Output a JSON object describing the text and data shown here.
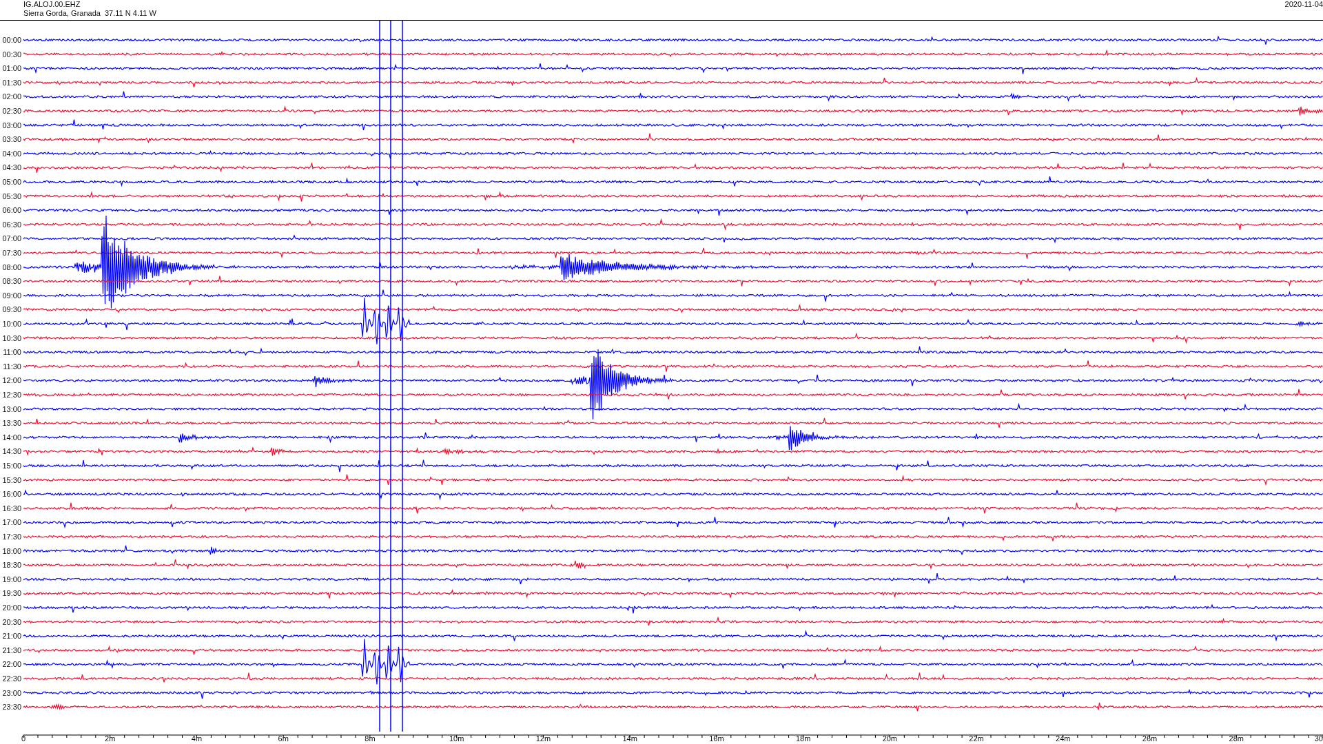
{
  "header": {
    "station": "IG.ALOJ.00.EHZ",
    "location": "Sierra Gorda, Granada  37.11 N 4.11 W",
    "date": "2020-11-04"
  },
  "helicorder": {
    "rows": [
      {
        "label": "00:00",
        "color": "#0000ff"
      },
      {
        "label": "00:30",
        "color": "#ee1133"
      },
      {
        "label": "01:00",
        "color": "#0000ff"
      },
      {
        "label": "01:30",
        "color": "#ee1133"
      },
      {
        "label": "02:00",
        "color": "#0000ff"
      },
      {
        "label": "02:30",
        "color": "#ee1133"
      },
      {
        "label": "03:00",
        "color": "#0000ff"
      },
      {
        "label": "03:30",
        "color": "#ee1133"
      },
      {
        "label": "04:00",
        "color": "#0000ff"
      },
      {
        "label": "04:30",
        "color": "#ee1133"
      },
      {
        "label": "05:00",
        "color": "#0000ff"
      },
      {
        "label": "05:30",
        "color": "#ee1133"
      },
      {
        "label": "06:00",
        "color": "#0000ff"
      },
      {
        "label": "06:30",
        "color": "#ee1133"
      },
      {
        "label": "07:00",
        "color": "#0000ff"
      },
      {
        "label": "07:30",
        "color": "#ee1133"
      },
      {
        "label": "08:00",
        "color": "#0000ff"
      },
      {
        "label": "08:30",
        "color": "#ee1133"
      },
      {
        "label": "09:00",
        "color": "#0000ff"
      },
      {
        "label": "09:30",
        "color": "#ee1133"
      },
      {
        "label": "10:00",
        "color": "#0000ff"
      },
      {
        "label": "10:30",
        "color": "#ee1133"
      },
      {
        "label": "11:00",
        "color": "#0000ff"
      },
      {
        "label": "11:30",
        "color": "#ee1133"
      },
      {
        "label": "12:00",
        "color": "#0000ff"
      },
      {
        "label": "12:30",
        "color": "#ee1133"
      },
      {
        "label": "13:00",
        "color": "#0000ff"
      },
      {
        "label": "13:30",
        "color": "#ee1133"
      },
      {
        "label": "14:00",
        "color": "#0000ff"
      },
      {
        "label": "14:30",
        "color": "#ee1133"
      },
      {
        "label": "15:00",
        "color": "#0000ff"
      },
      {
        "label": "15:30",
        "color": "#ee1133"
      },
      {
        "label": "16:00",
        "color": "#0000ff"
      },
      {
        "label": "16:30",
        "color": "#ee1133"
      },
      {
        "label": "17:00",
        "color": "#0000ff"
      },
      {
        "label": "17:30",
        "color": "#ee1133"
      },
      {
        "label": "18:00",
        "color": "#0000ff"
      },
      {
        "label": "18:30",
        "color": "#ee1133"
      },
      {
        "label": "19:00",
        "color": "#0000ff"
      },
      {
        "label": "19:30",
        "color": "#ee1133"
      },
      {
        "label": "20:00",
        "color": "#0000ff"
      },
      {
        "label": "20:30",
        "color": "#ee1133"
      },
      {
        "label": "21:00",
        "color": "#0000ff"
      },
      {
        "label": "21:30",
        "color": "#ee1133"
      },
      {
        "label": "22:00",
        "color": "#0000ff"
      },
      {
        "label": "22:30",
        "color": "#ee1133"
      },
      {
        "label": "23:00",
        "color": "#0000ff"
      },
      {
        "label": "23:30",
        "color": "#ee1133"
      }
    ],
    "x_axis": {
      "labels": [
        "0",
        "2m",
        "4m",
        "6m",
        "8m",
        "10m",
        "12m",
        "14m",
        "16m",
        "18m",
        "20m",
        "22m",
        "24m",
        "26m",
        "28m",
        "30"
      ]
    }
  }
}
